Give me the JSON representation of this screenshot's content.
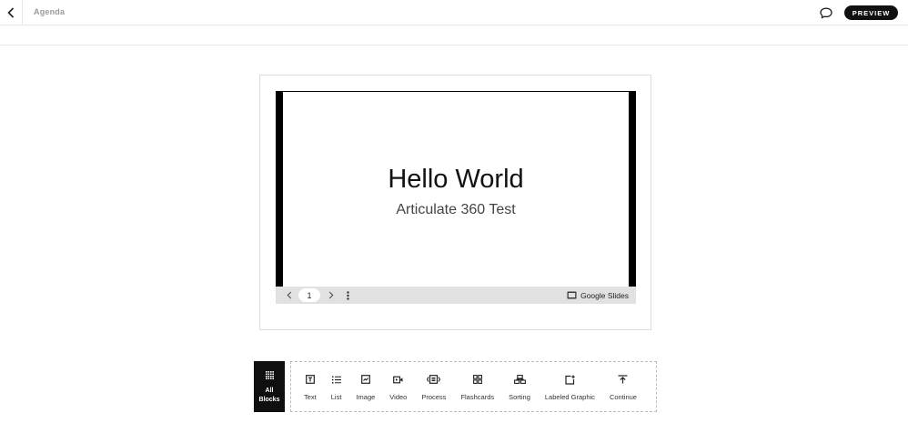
{
  "header": {
    "back_icon": "chevron-left-icon",
    "breadcrumb": "Agenda",
    "comment_icon": "comment-icon",
    "preview_label": "PREVIEW"
  },
  "embed": {
    "slide_title": "Hello World",
    "slide_subtitle": "Articulate 360 Test",
    "page_number": "1",
    "provider_label": "Google Slides",
    "provider_icon": "slides-icon"
  },
  "toolbar": {
    "all_blocks_label_1": "All",
    "all_blocks_label_2": "Blocks",
    "blocks": [
      {
        "label": "Text",
        "icon": "text-icon"
      },
      {
        "label": "List",
        "icon": "list-icon"
      },
      {
        "label": "Image",
        "icon": "image-icon"
      },
      {
        "label": "Video",
        "icon": "video-icon"
      },
      {
        "label": "Process",
        "icon": "process-icon"
      },
      {
        "label": "Flashcards",
        "icon": "flashcards-icon"
      },
      {
        "label": "Sorting",
        "icon": "sorting-icon"
      },
      {
        "label": "Labeled Graphic",
        "icon": "labeled-graphic-icon"
      },
      {
        "label": "Continue",
        "icon": "continue-icon"
      }
    ]
  },
  "colors": {
    "preview_bg": "#111111",
    "all_blocks_bg": "#0f0f0f",
    "slide_frame": "#000000",
    "controls_bg": "#e1e1e1"
  }
}
